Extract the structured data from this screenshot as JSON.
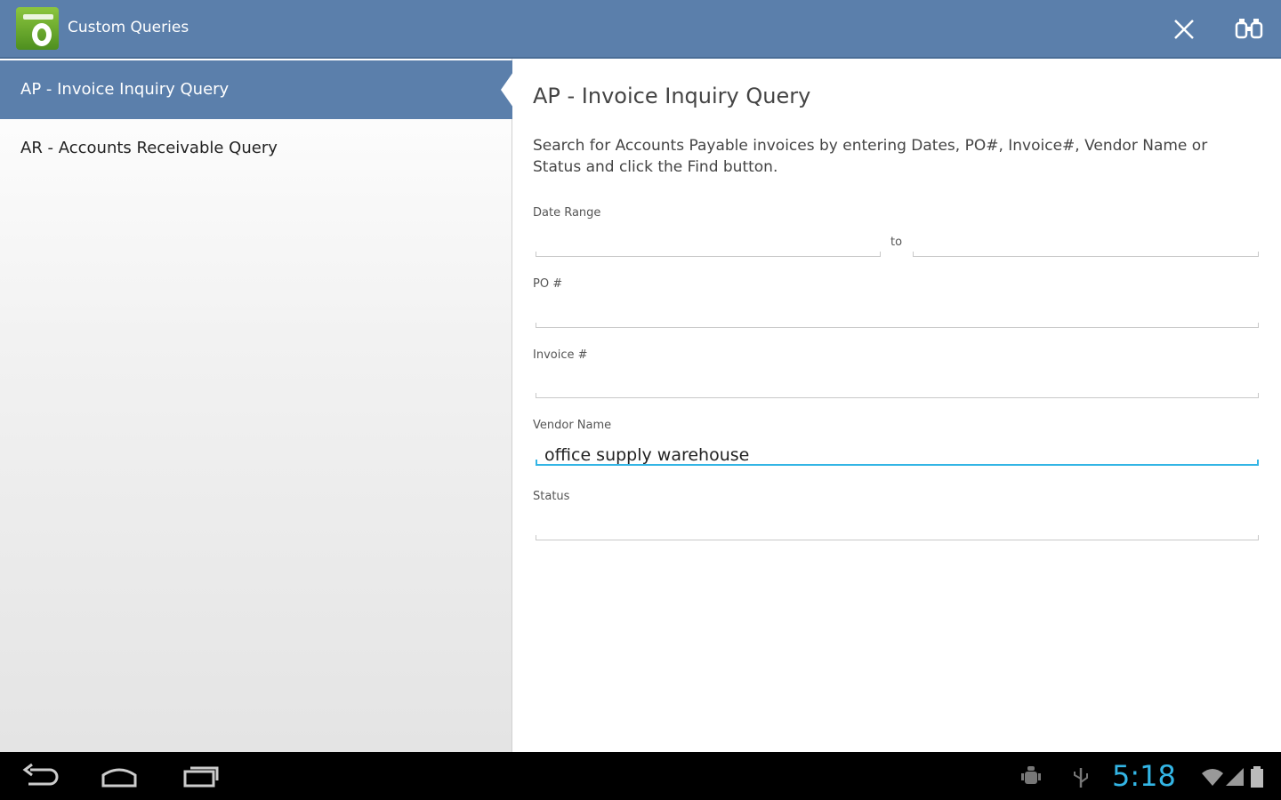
{
  "app": {
    "title": "Custom Queries",
    "icon": "app-logo-icon",
    "actions": [
      {
        "name": "close-icon"
      },
      {
        "name": "find-binoculars-icon"
      }
    ],
    "accent_color": "#5b7fab"
  },
  "sidebar": {
    "items": [
      {
        "label": "AP - Invoice Inquiry Query",
        "selected": true
      },
      {
        "label": "AR - Accounts Receivable Query",
        "selected": false
      }
    ]
  },
  "detail": {
    "title": "AP - Invoice Inquiry Query",
    "description": "Search for Accounts Payable invoices by entering Dates, PO#, Invoice#, Vendor Name or Status and click the Find button.",
    "date_range": {
      "label": "Date Range",
      "to_label": "to",
      "from_value": "",
      "to_value": ""
    },
    "po": {
      "label": "PO #",
      "value": ""
    },
    "invoice": {
      "label": "Invoice #",
      "value": ""
    },
    "vendor": {
      "label": "Vendor Name",
      "value": "office supply warehouse"
    },
    "status": {
      "label": "Status",
      "value": ""
    },
    "focus_color": "#33b5e5"
  },
  "system_bar": {
    "buttons": [
      "back-icon",
      "home-icon",
      "recent-apps-icon"
    ],
    "status_icons": [
      "android-debug-icon",
      "usb-icon",
      "wifi-icon",
      "signal-icon",
      "battery-icon"
    ],
    "time": "5:18",
    "clock_color": "#33b5e5"
  }
}
